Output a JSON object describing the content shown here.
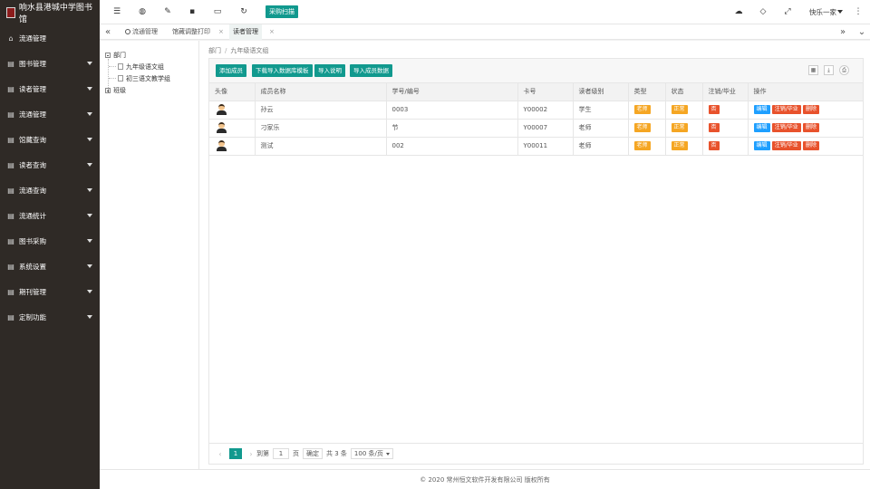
{
  "brand": {
    "title": "响水县港城中学图书馆"
  },
  "sidebar": {
    "items": [
      {
        "label": "流通管理",
        "icon": "home-icon",
        "arrow": false
      },
      {
        "label": "图书管理",
        "icon": "book-icon",
        "arrow": true
      },
      {
        "label": "读者管理",
        "icon": "reader-icon",
        "arrow": true
      },
      {
        "label": "流通管理",
        "icon": "circulation-icon",
        "arrow": true
      },
      {
        "label": "馆藏查询",
        "icon": "search-icon",
        "arrow": true
      },
      {
        "label": "读者查询",
        "icon": "reader-search-icon",
        "arrow": true
      },
      {
        "label": "流通查询",
        "icon": "circulation-search-icon",
        "arrow": true
      },
      {
        "label": "流通统计",
        "icon": "stats-icon",
        "arrow": true
      },
      {
        "label": "图书采购",
        "icon": "purchase-icon",
        "arrow": true
      },
      {
        "label": "系统设置",
        "icon": "settings-icon",
        "arrow": true
      },
      {
        "label": "期刊管理",
        "icon": "journal-icon",
        "arrow": true
      },
      {
        "label": "定制功能",
        "icon": "custom-icon",
        "arrow": true
      }
    ]
  },
  "header": {
    "purchase_button": "采购扫描",
    "user_name": "快乐一家"
  },
  "tabs": [
    {
      "label": "流通管理",
      "active": false,
      "closable": false
    },
    {
      "label": "馆藏调整打印",
      "active": false,
      "closable": true
    },
    {
      "label": "读者管理",
      "active": true,
      "closable": true
    }
  ],
  "tree": {
    "root": "部门",
    "children": [
      "九年级语文组",
      "初三语文教学组"
    ],
    "second_root": "班级"
  },
  "breadcrumb": {
    "level1": "部门",
    "separator": "/",
    "level2": "九年级语文组"
  },
  "toolbar": {
    "add_member": "添加成员",
    "download_template": "下载导入数据库模板",
    "import_help": "导入说明",
    "import_data": "导入成员数据"
  },
  "table": {
    "columns": [
      "头像",
      "成员名称",
      "学号/编号",
      "卡号",
      "读者级别",
      "类型",
      "状态",
      "注销/毕业",
      "操作"
    ],
    "rows": [
      {
        "name": "孙云",
        "number": "0003",
        "card": "Y00002",
        "level": "学生",
        "type": "老师",
        "status": "正常",
        "cancelled": "否",
        "actions": [
          "编辑",
          "注销/毕业",
          "删除"
        ]
      },
      {
        "name": "刁家乐",
        "number": "节",
        "card": "Y00007",
        "level": "老师",
        "type": "老师",
        "status": "正常",
        "cancelled": "否",
        "actions": [
          "编辑",
          "注销/毕业",
          "删除"
        ]
      },
      {
        "name": "测试",
        "number": "002",
        "card": "Y00011",
        "level": "老师",
        "type": "老师",
        "status": "正常",
        "cancelled": "否",
        "actions": [
          "编辑",
          "注销/毕业",
          "删除"
        ]
      }
    ]
  },
  "pager": {
    "current_page": "1",
    "goto_label": "到第",
    "goto_value": "1",
    "page_suffix": "页",
    "confirm": "确定",
    "total": "共 3 条",
    "page_size": "100 条/页"
  },
  "footer": {
    "copyright": "© 2020 常州恒文软件开发有限公司 版权所有"
  },
  "colors": {
    "accent": "#11998e",
    "sidebar_bg": "#2f2a26",
    "tag_orange": "#f5a623",
    "tag_red": "#e8522c",
    "tag_blue": "#1e9fff"
  }
}
